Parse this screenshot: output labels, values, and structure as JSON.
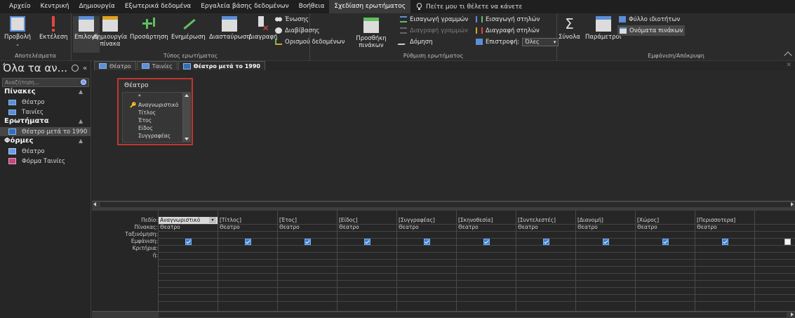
{
  "menubar": {
    "items": [
      "Αρχείο",
      "Κεντρική",
      "Δημιουργία",
      "Εξωτερικά δεδομένα",
      "Εργαλεία βάσης δεδομένων",
      "Βοήθεια",
      "Σχεδίαση ερωτήματος"
    ],
    "tell_me": "Πείτε μου τι θέλετε να κάνετε"
  },
  "ribbon": {
    "results": {
      "view": "Προβολή",
      "run": "Εκτέλεση",
      "label": "Αποτελέσματα"
    },
    "query_type": {
      "select": "Επιλογή",
      "make_table": "Δημιουργία πίνακα",
      "append": "Προσάρτηση",
      "update": "Ενημέρωση",
      "crosstab": "Διασταύρωση",
      "delete": "Διαγραφή",
      "union": "Ένωσης",
      "pass_through": "Διαβίβασης",
      "data_definition": "Ορισμού δεδομένων",
      "label": "Τύπος ερωτήματος"
    },
    "setup": {
      "show_table": "Προσθήκη πινάκων",
      "insert_rows": "Εισαγωγή γραμμών",
      "delete_rows": "Διαγραφή γραμμών",
      "builder": "Δόμηση",
      "insert_columns": "Εισαγωγή στηλών",
      "delete_columns": "Διαγραφή στηλών",
      "return_label": "Επιστροφή:",
      "return_value": "Όλες",
      "label": "Ρύθμιση ερωτήματος"
    },
    "show_hide": {
      "totals": "Σύνολα",
      "parameters": "Παράμετροι",
      "property_sheet": "Φύλλο ιδιοτήτων",
      "table_names": "Ονόματα πινάκων",
      "label": "Εμφάνιση/Απόκρυψη"
    }
  },
  "nav": {
    "header": "Όλα τα αν...",
    "search_placeholder": "Αναζήτηση...",
    "categories": [
      {
        "name": "Πίνακες",
        "items": [
          "Θέατρο",
          "Ταινίες"
        ]
      },
      {
        "name": "Ερωτήματα",
        "items": [
          "Θέατρο μετά το 1990"
        ]
      },
      {
        "name": "Φόρμες",
        "items": [
          "Θέατρο",
          "Φόρμα Ταινίες"
        ]
      }
    ]
  },
  "tabs": [
    "Θέατρο",
    "Ταινίες",
    "Θέατρο μετά το 1990"
  ],
  "table_box": {
    "title": "Θέατρο",
    "fields": [
      "*",
      "Αναγνωριστικό",
      "Τίτλος",
      "Έτος",
      "Είδος",
      "Συγγραφέας"
    ]
  },
  "grid": {
    "row_labels": [
      "Πεδίο:",
      "Πίνακας:",
      "Ταξινόμηση:",
      "Εμφάνιση:",
      "Κριτήρια:",
      "ή:"
    ],
    "columns": [
      {
        "field": "Αναγνωριστικό",
        "table": "Θεατρο",
        "show": true
      },
      {
        "field": "[Τίτλος]",
        "table": "Θεατρο",
        "show": true
      },
      {
        "field": "[Έτος]",
        "table": "Θεατρο",
        "show": true
      },
      {
        "field": "[Είδος]",
        "table": "Θεατρο",
        "show": true
      },
      {
        "field": "[Συγγραφέας]",
        "table": "Θεατρο",
        "show": true
      },
      {
        "field": "[Σκηνοθεσία]",
        "table": "Θεατρο",
        "show": true
      },
      {
        "field": "[Συντελεστές]",
        "table": "Θεατρο",
        "show": true
      },
      {
        "field": "[Διανομή]",
        "table": "Θεατρο",
        "show": true
      },
      {
        "field": "[Χώρος]",
        "table": "Θεατρο",
        "show": true
      },
      {
        "field": "[Περισσοτερα]",
        "table": "Θεατρο",
        "show": true
      },
      {
        "field": "",
        "table": "",
        "show": false
      }
    ]
  }
}
